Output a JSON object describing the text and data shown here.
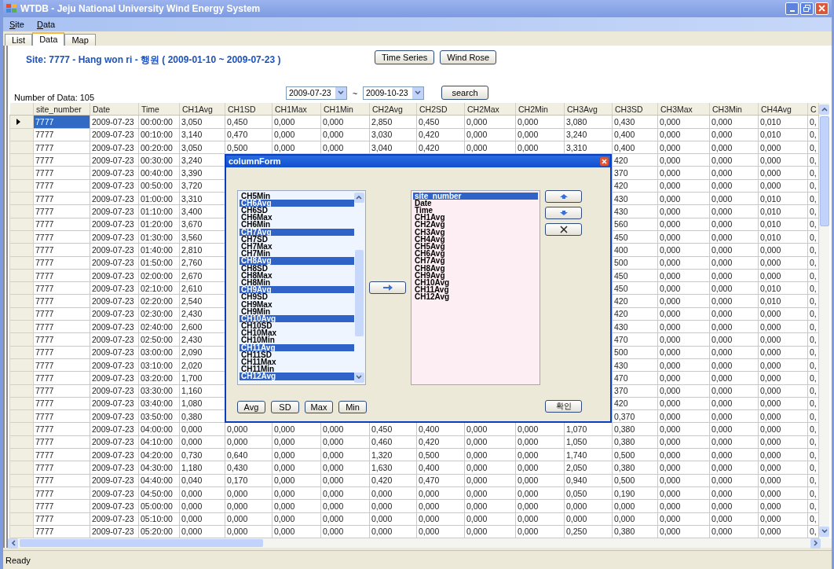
{
  "window": {
    "title": "WTDB - Jeju National University Wind Energy System"
  },
  "menu": [
    {
      "label": "Site"
    },
    {
      "label": "Data"
    }
  ],
  "tabs": [
    {
      "label": "List",
      "selected": false
    },
    {
      "label": "Data",
      "selected": true
    },
    {
      "label": "Map",
      "selected": false
    }
  ],
  "site_label": "Site: 7777 - Hang won ri - 행원 ( 2009-01-10 ~ 2009-07-23 )",
  "buttons": [
    "Time Series",
    "Wind Rose"
  ],
  "data_count": "Number of Data: 105",
  "date_from": "2009-07-23",
  "range_separator": "~",
  "date_to": "2009-10-23",
  "search_button": "search",
  "table": {
    "columns": [
      "site_number",
      "Date",
      "Time",
      "CH1Avg",
      "CH1SD",
      "CH1Max",
      "CH1Min",
      "CH2Avg",
      "CH2SD",
      "CH2Max",
      "CH2Min",
      "CH3Avg",
      "CH3SD",
      "CH3Max",
      "CH3Min",
      "CH4Avg",
      "C"
    ],
    "rows": [
      {
        "selected": true,
        "cells": [
          "7777",
          "2009-07-23",
          "00:00:00",
          "3,050",
          "0,450",
          "0,000",
          "0,000",
          "2,850",
          "0,450",
          "0,000",
          "0,000",
          "3,080",
          "0,430",
          "0,000",
          "0,000",
          "0,010",
          "0,"
        ]
      },
      {
        "selected": false,
        "cells": [
          "7777",
          "2009-07-23",
          "00:10:00",
          "3,140",
          "0,470",
          "0,000",
          "0,000",
          "3,030",
          "0,420",
          "0,000",
          "0,000",
          "3,240",
          "0,400",
          "0,000",
          "0,000",
          "0,010",
          "0,"
        ]
      },
      {
        "selected": false,
        "cells": [
          "7777",
          "2009-07-23",
          "00:20:00",
          "3,050",
          "0,500",
          "0,000",
          "0,000",
          "3,040",
          "0,420",
          "0,000",
          "0,000",
          "3,310",
          "0,400",
          "0,000",
          "0,000",
          "0,000",
          "0,"
        ]
      },
      {
        "selected": false,
        "cells": [
          "7777",
          "2009-07-23",
          "00:30:00",
          "3,240",
          null,
          null,
          null,
          null,
          null,
          null,
          null,
          null,
          "420",
          "0,000",
          "0,000",
          "0,000",
          "0,"
        ]
      },
      {
        "selected": false,
        "cells": [
          "7777",
          "2009-07-23",
          "00:40:00",
          "3,390",
          null,
          null,
          null,
          null,
          null,
          null,
          null,
          null,
          "370",
          "0,000",
          "0,000",
          "0,000",
          "0,"
        ]
      },
      {
        "selected": false,
        "cells": [
          "7777",
          "2009-07-23",
          "00:50:00",
          "3,720",
          null,
          null,
          null,
          null,
          null,
          null,
          null,
          null,
          "420",
          "0,000",
          "0,000",
          "0,000",
          "0,"
        ]
      },
      {
        "selected": false,
        "cells": [
          "7777",
          "2009-07-23",
          "01:00:00",
          "3,310",
          null,
          null,
          null,
          null,
          null,
          null,
          null,
          null,
          "430",
          "0,000",
          "0,000",
          "0,010",
          "0,"
        ]
      },
      {
        "selected": false,
        "cells": [
          "7777",
          "2009-07-23",
          "01:10:00",
          "3,400",
          null,
          null,
          null,
          null,
          null,
          null,
          null,
          null,
          "430",
          "0,000",
          "0,000",
          "0,010",
          "0,"
        ]
      },
      {
        "selected": false,
        "cells": [
          "7777",
          "2009-07-23",
          "01:20:00",
          "3,670",
          null,
          null,
          null,
          null,
          null,
          null,
          null,
          null,
          "560",
          "0,000",
          "0,000",
          "0,010",
          "0,"
        ]
      },
      {
        "selected": false,
        "cells": [
          "7777",
          "2009-07-23",
          "01:30:00",
          "3,560",
          null,
          null,
          null,
          null,
          null,
          null,
          null,
          null,
          "450",
          "0,000",
          "0,000",
          "0,010",
          "0,"
        ]
      },
      {
        "selected": false,
        "cells": [
          "7777",
          "2009-07-23",
          "01:40:00",
          "2,810",
          null,
          null,
          null,
          null,
          null,
          null,
          null,
          null,
          "400",
          "0,000",
          "0,000",
          "0,000",
          "0,"
        ]
      },
      {
        "selected": false,
        "cells": [
          "7777",
          "2009-07-23",
          "01:50:00",
          "2,760",
          null,
          null,
          null,
          null,
          null,
          null,
          null,
          null,
          "500",
          "0,000",
          "0,000",
          "0,000",
          "0,"
        ]
      },
      {
        "selected": false,
        "cells": [
          "7777",
          "2009-07-23",
          "02:00:00",
          "2,670",
          null,
          null,
          null,
          null,
          null,
          null,
          null,
          null,
          "450",
          "0,000",
          "0,000",
          "0,000",
          "0,"
        ]
      },
      {
        "selected": false,
        "cells": [
          "7777",
          "2009-07-23",
          "02:10:00",
          "2,610",
          null,
          null,
          null,
          null,
          null,
          null,
          null,
          null,
          "450",
          "0,000",
          "0,000",
          "0,010",
          "0,"
        ]
      },
      {
        "selected": false,
        "cells": [
          "7777",
          "2009-07-23",
          "02:20:00",
          "2,540",
          null,
          null,
          null,
          null,
          null,
          null,
          null,
          null,
          "420",
          "0,000",
          "0,000",
          "0,010",
          "0,"
        ]
      },
      {
        "selected": false,
        "cells": [
          "7777",
          "2009-07-23",
          "02:30:00",
          "2,430",
          null,
          null,
          null,
          null,
          null,
          null,
          null,
          null,
          "420",
          "0,000",
          "0,000",
          "0,000",
          "0,"
        ]
      },
      {
        "selected": false,
        "cells": [
          "7777",
          "2009-07-23",
          "02:40:00",
          "2,600",
          null,
          null,
          null,
          null,
          null,
          null,
          null,
          null,
          "430",
          "0,000",
          "0,000",
          "0,000",
          "0,"
        ]
      },
      {
        "selected": false,
        "cells": [
          "7777",
          "2009-07-23",
          "02:50:00",
          "2,430",
          null,
          null,
          null,
          null,
          null,
          null,
          null,
          null,
          "470",
          "0,000",
          "0,000",
          "0,000",
          "0,"
        ]
      },
      {
        "selected": false,
        "cells": [
          "7777",
          "2009-07-23",
          "03:00:00",
          "2,090",
          null,
          null,
          null,
          null,
          null,
          null,
          null,
          null,
          "500",
          "0,000",
          "0,000",
          "0,000",
          "0,"
        ]
      },
      {
        "selected": false,
        "cells": [
          "7777",
          "2009-07-23",
          "03:10:00",
          "2,020",
          null,
          null,
          null,
          null,
          null,
          null,
          null,
          null,
          "430",
          "0,000",
          "0,000",
          "0,000",
          "0,"
        ]
      },
      {
        "selected": false,
        "cells": [
          "7777",
          "2009-07-23",
          "03:20:00",
          "1,700",
          null,
          null,
          null,
          null,
          null,
          null,
          null,
          null,
          "470",
          "0,000",
          "0,000",
          "0,000",
          "0,"
        ]
      },
      {
        "selected": false,
        "cells": [
          "7777",
          "2009-07-23",
          "03:30:00",
          "1,160",
          null,
          null,
          null,
          null,
          null,
          null,
          null,
          null,
          "370",
          "0,000",
          "0,000",
          "0,000",
          "0,"
        ]
      },
      {
        "selected": false,
        "cells": [
          "7777",
          "2009-07-23",
          "03:40:00",
          "1,080",
          null,
          null,
          null,
          null,
          null,
          null,
          null,
          null,
          "420",
          "0,000",
          "0,000",
          "0,000",
          "0,"
        ]
      },
      {
        "selected": false,
        "cells": [
          "7777",
          "2009-07-23",
          "03:50:00",
          "0,380",
          null,
          null,
          null,
          null,
          null,
          null,
          null,
          null,
          "0,370",
          "0,000",
          "0,000",
          "0,000",
          "0,"
        ]
      },
      {
        "selected": false,
        "cells": [
          "7777",
          "2009-07-23",
          "04:00:00",
          "0,000",
          "0,000",
          "0,000",
          "0,000",
          "0,450",
          "0,400",
          "0,000",
          "0,000",
          "1,070",
          "0,380",
          "0,000",
          "0,000",
          "0,000",
          "0,"
        ]
      },
      {
        "selected": false,
        "cells": [
          "7777",
          "2009-07-23",
          "04:10:00",
          "0,000",
          "0,000",
          "0,000",
          "0,000",
          "0,460",
          "0,420",
          "0,000",
          "0,000",
          "1,050",
          "0,380",
          "0,000",
          "0,000",
          "0,000",
          "0,"
        ]
      },
      {
        "selected": false,
        "cells": [
          "7777",
          "2009-07-23",
          "04:20:00",
          "0,730",
          "0,640",
          "0,000",
          "0,000",
          "1,320",
          "0,500",
          "0,000",
          "0,000",
          "1,740",
          "0,500",
          "0,000",
          "0,000",
          "0,000",
          "0,"
        ]
      },
      {
        "selected": false,
        "cells": [
          "7777",
          "2009-07-23",
          "04:30:00",
          "1,180",
          "0,430",
          "0,000",
          "0,000",
          "1,630",
          "0,400",
          "0,000",
          "0,000",
          "2,050",
          "0,380",
          "0,000",
          "0,000",
          "0,000",
          "0,"
        ]
      },
      {
        "selected": false,
        "cells": [
          "7777",
          "2009-07-23",
          "04:40:00",
          "0,040",
          "0,170",
          "0,000",
          "0,000",
          "0,420",
          "0,470",
          "0,000",
          "0,000",
          "0,940",
          "0,500",
          "0,000",
          "0,000",
          "0,000",
          "0,"
        ]
      },
      {
        "selected": false,
        "cells": [
          "7777",
          "2009-07-23",
          "04:50:00",
          "0,000",
          "0,000",
          "0,000",
          "0,000",
          "0,000",
          "0,000",
          "0,000",
          "0,000",
          "0,050",
          "0,190",
          "0,000",
          "0,000",
          "0,000",
          "0,"
        ]
      },
      {
        "selected": false,
        "cells": [
          "7777",
          "2009-07-23",
          "05:00:00",
          "0,000",
          "0,000",
          "0,000",
          "0,000",
          "0,000",
          "0,000",
          "0,000",
          "0,000",
          "0,000",
          "0,000",
          "0,000",
          "0,000",
          "0,000",
          "0,"
        ]
      },
      {
        "selected": false,
        "cells": [
          "7777",
          "2009-07-23",
          "05:10:00",
          "0,000",
          "0,000",
          "0,000",
          "0,000",
          "0,000",
          "0,000",
          "0,000",
          "0,000",
          "0,000",
          "0,000",
          "0,000",
          "0,000",
          "0,000",
          "0,"
        ]
      },
      {
        "selected": false,
        "cells": [
          "7777",
          "2009-07-23",
          "05:20:00",
          "0,000",
          "0,000",
          "0,000",
          "0,000",
          "0,000",
          "0,000",
          "0,000",
          "0,000",
          "0,250",
          "0,380",
          "0,000",
          "0,000",
          "0,000",
          "0,"
        ]
      }
    ]
  },
  "dialog": {
    "title": "columnForm",
    "available": [
      {
        "label": "CH5Min",
        "selected": false
      },
      {
        "label": "CH6Avg",
        "selected": true
      },
      {
        "label": "CH6SD",
        "selected": false
      },
      {
        "label": "CH6Max",
        "selected": false
      },
      {
        "label": "CH6Min",
        "selected": false
      },
      {
        "label": "CH7Avg",
        "selected": true
      },
      {
        "label": "CH7SD",
        "selected": false
      },
      {
        "label": "CH7Max",
        "selected": false
      },
      {
        "label": "CH7Min",
        "selected": false
      },
      {
        "label": "CH8Avg",
        "selected": true
      },
      {
        "label": "CH8SD",
        "selected": false
      },
      {
        "label": "CH8Max",
        "selected": false
      },
      {
        "label": "CH8Min",
        "selected": false
      },
      {
        "label": "CH9Avg",
        "selected": true
      },
      {
        "label": "CH9SD",
        "selected": false
      },
      {
        "label": "CH9Max",
        "selected": false
      },
      {
        "label": "CH9Min",
        "selected": false
      },
      {
        "label": "CH10Avg",
        "selected": true
      },
      {
        "label": "CH10SD",
        "selected": false
      },
      {
        "label": "CH10Max",
        "selected": false
      },
      {
        "label": "CH10Min",
        "selected": false
      },
      {
        "label": "CH11Avg",
        "selected": true
      },
      {
        "label": "CH11SD",
        "selected": false
      },
      {
        "label": "CH11Max",
        "selected": false
      },
      {
        "label": "CH11Min",
        "selected": false
      },
      {
        "label": "CH12Avg",
        "selected": true
      }
    ],
    "chosen": [
      {
        "label": "site_number",
        "selected": true
      },
      {
        "label": "Date",
        "selected": false
      },
      {
        "label": "Time",
        "selected": false
      },
      {
        "label": "CH1Avg",
        "selected": false
      },
      {
        "label": "CH2Avg",
        "selected": false
      },
      {
        "label": "CH3Avg",
        "selected": false
      },
      {
        "label": "CH4Avg",
        "selected": false
      },
      {
        "label": "CH5Avg",
        "selected": false
      },
      {
        "label": "CH6Avg",
        "selected": false
      },
      {
        "label": "CH7Avg",
        "selected": false
      },
      {
        "label": "CH8Avg",
        "selected": false
      },
      {
        "label": "CH9Avg",
        "selected": false
      },
      {
        "label": "CH10Avg",
        "selected": false
      },
      {
        "label": "CH11Avg",
        "selected": false
      },
      {
        "label": "CH12Avg",
        "selected": false
      }
    ],
    "filter_buttons": [
      "Avg",
      "SD",
      "Max",
      "Min"
    ],
    "ok_button": "확인"
  },
  "status_bar": "Ready"
}
